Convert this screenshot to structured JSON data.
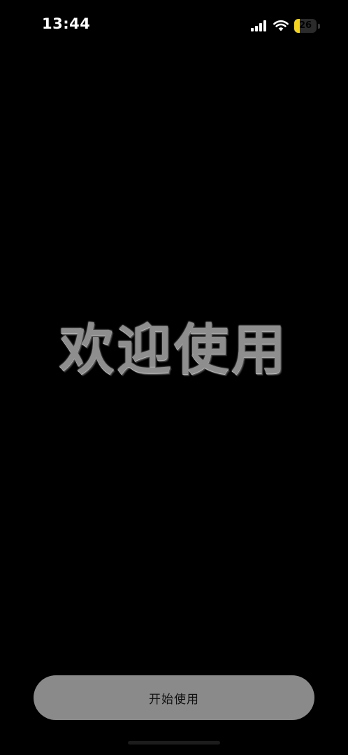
{
  "status_bar": {
    "time": "13:44",
    "battery_level": "26",
    "battery_percent": 26,
    "battery_color": "#f4d21f",
    "icons": [
      "cellular-signal-icon",
      "wifi-icon",
      "battery-icon"
    ]
  },
  "welcome": {
    "title": "欢迎使用"
  },
  "start_button": {
    "label": "开始使用",
    "background_color": "#8a8a8a"
  },
  "colors": {
    "background": "#000000",
    "title_gray": "#8e8e8e"
  }
}
